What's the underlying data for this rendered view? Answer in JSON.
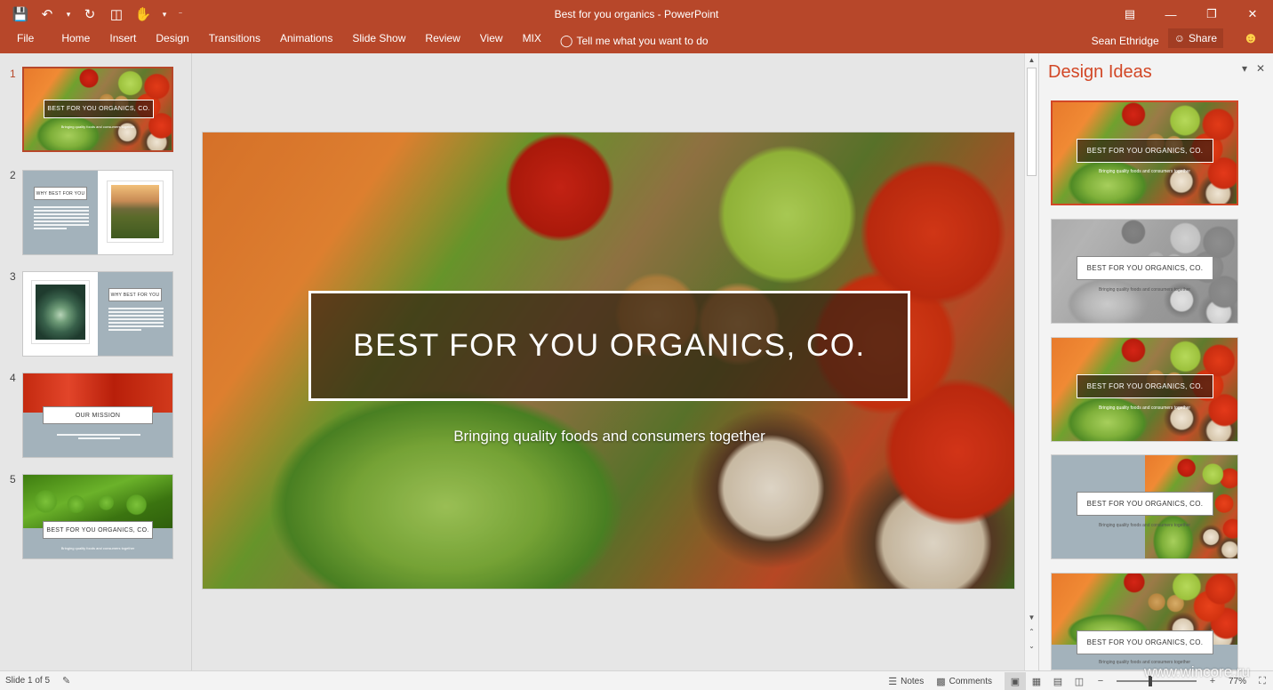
{
  "window": {
    "title": "Best for you organics - PowerPoint"
  },
  "qat": {
    "save_icon": "save-icon",
    "undo_icon": "undo-icon",
    "redo_icon": "redo-icon",
    "present_icon": "present-icon",
    "touch_icon": "touch-mode-icon",
    "customize_icon": "customize-icon"
  },
  "ribbon": {
    "tabs": [
      "File",
      "Home",
      "Insert",
      "Design",
      "Transitions",
      "Animations",
      "Slide Show",
      "Review",
      "View",
      "MIX"
    ],
    "tell_me": "Tell me what you want to do",
    "user": "Sean Ethridge",
    "share": "Share"
  },
  "thumbnails": [
    {
      "number": "1",
      "title": "BEST FOR YOU ORGANICS, CO.",
      "subtitle": "Bringing quality foods and consumers together"
    },
    {
      "number": "2",
      "title": "WHY BEST FOR YOU"
    },
    {
      "number": "3",
      "title": "WHY BEST FOR YOU"
    },
    {
      "number": "4",
      "title": "OUR MISSION"
    },
    {
      "number": "5",
      "title": "BEST FOR YOU ORGANICS, CO.",
      "subtitle": "Bringing quality foods and consumers together"
    }
  ],
  "slide": {
    "title": "BEST FOR YOU ORGANICS, CO.",
    "subtitle": "Bringing quality foods and consumers together"
  },
  "design_ideas": {
    "title": "Design Ideas",
    "items": [
      {
        "title": "BEST FOR YOU ORGANICS, CO.",
        "subtitle": "Bringing quality foods and consumers together"
      },
      {
        "title": "BEST FOR YOU ORGANICS, CO.",
        "subtitle": "Bringing quality foods and consumers together"
      },
      {
        "title": "BEST FOR YOU ORGANICS, CO.",
        "subtitle": "Bringing quality foods and consumers together"
      },
      {
        "title": "BEST FOR YOU ORGANICS, CO.",
        "subtitle": "Bringing quality foods and consumers together"
      },
      {
        "title": "BEST FOR YOU ORGANICS, CO.",
        "subtitle": "Bringing quality foods and consumers together"
      }
    ]
  },
  "status": {
    "slide_info": "Slide 1 of 5",
    "notes": "Notes",
    "comments": "Comments",
    "zoom": "77%",
    "watermark": "www.wincore.ru"
  },
  "colors": {
    "accent": "#b7472a",
    "design_title": "#d24726"
  }
}
